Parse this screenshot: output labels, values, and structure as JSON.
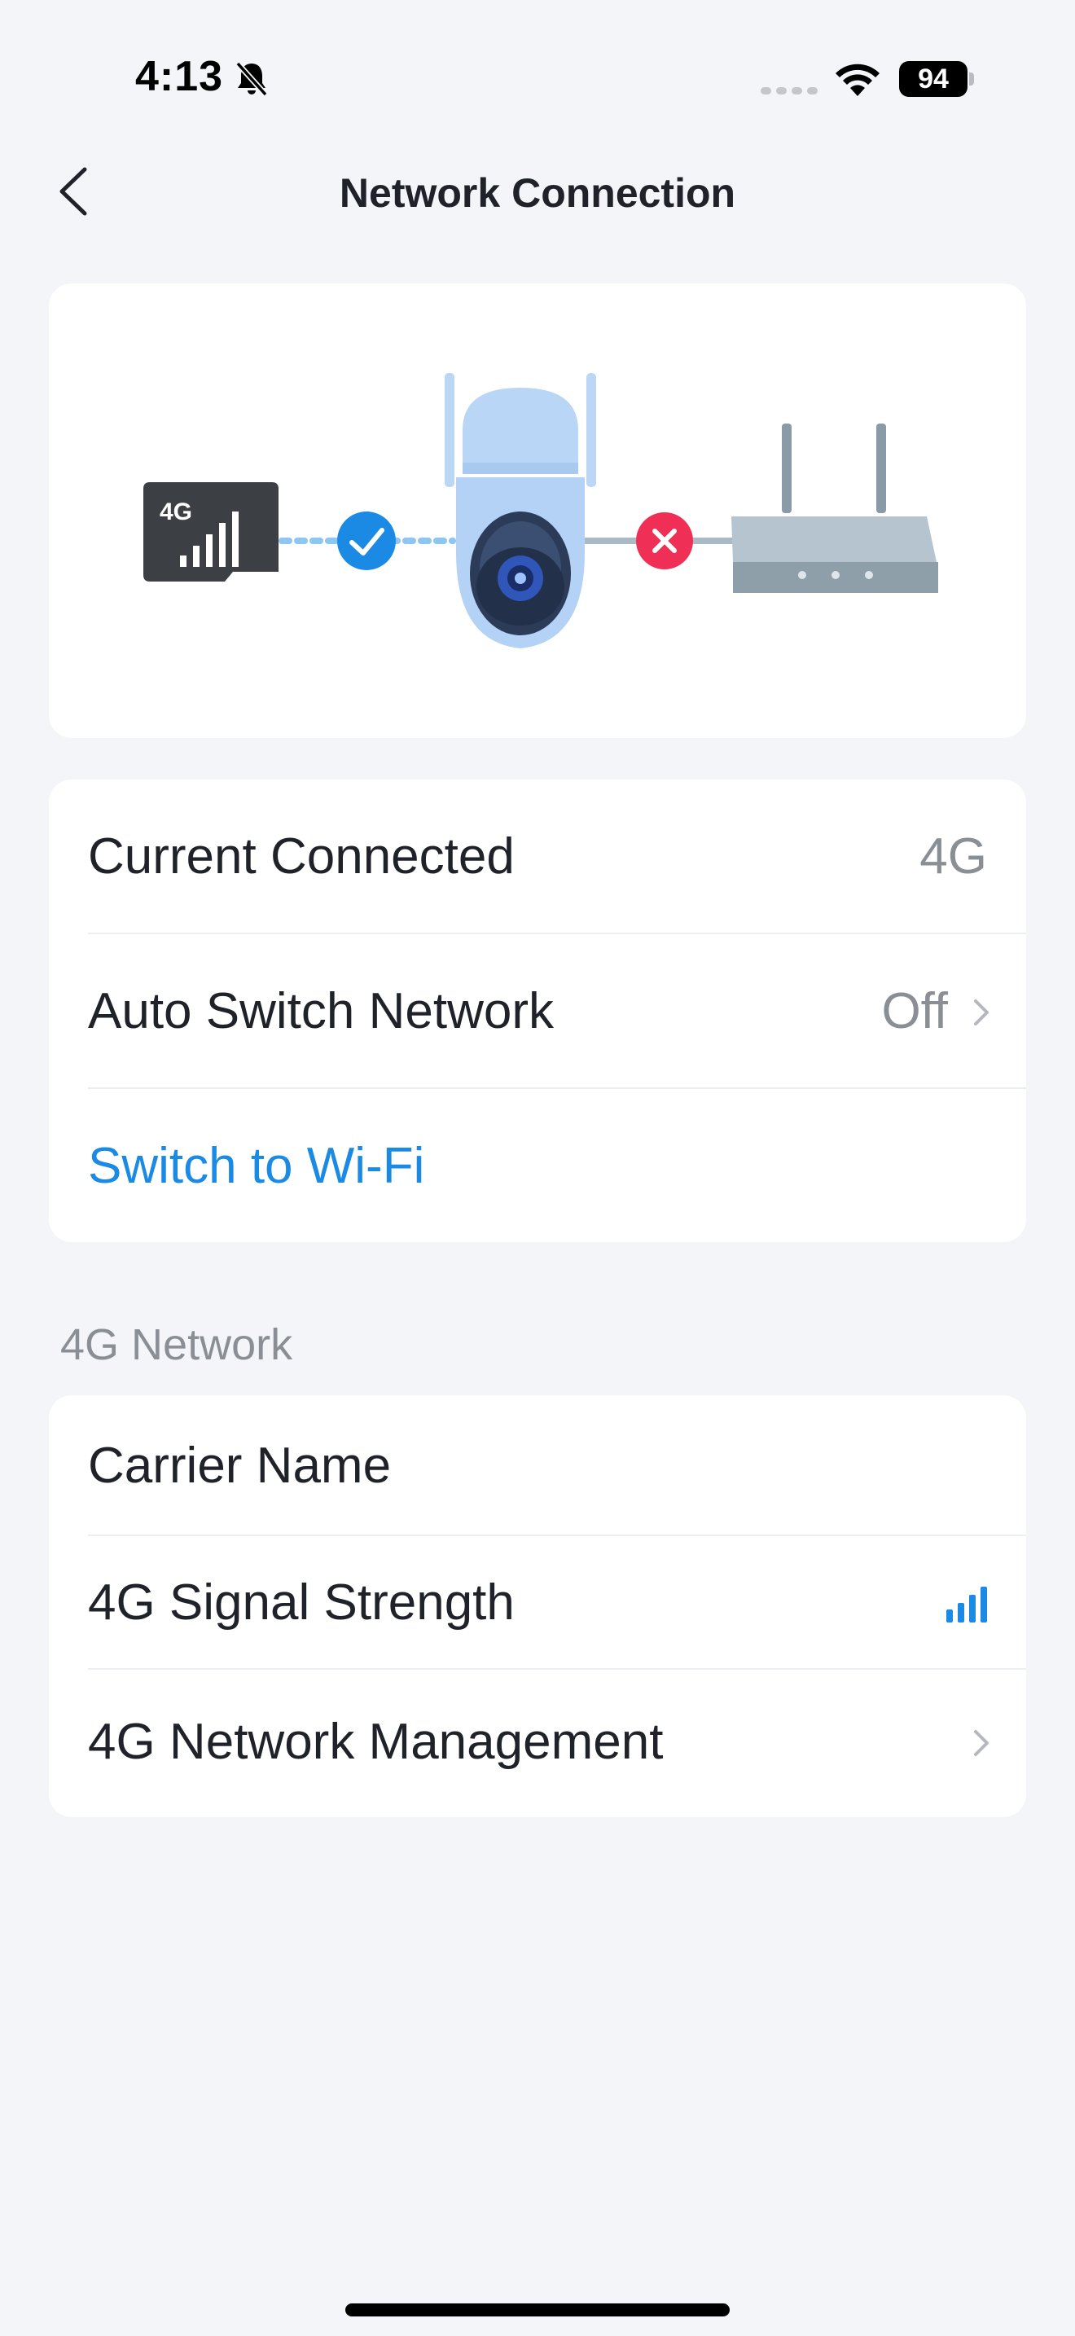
{
  "status_bar": {
    "time": "4:13",
    "battery": "94"
  },
  "header": {
    "title": "Network Connection"
  },
  "illustration": {
    "sd_card_label": "4G"
  },
  "connection": {
    "current_connected_label": "Current Connected",
    "current_connected_value": "4G",
    "auto_switch_label": "Auto Switch Network",
    "auto_switch_value": "Off",
    "switch_wifi_label": "Switch to Wi-Fi"
  },
  "network_4g": {
    "section_title": "4G Network",
    "carrier_name_label": "Carrier Name",
    "signal_strength_label": "4G Signal Strength",
    "signal_level": 4,
    "signal_max": 4,
    "management_label": "4G Network Management"
  },
  "colors": {
    "accent": "#1a8ae5",
    "error": "#ef2f56",
    "background": "#f3f5f9"
  }
}
